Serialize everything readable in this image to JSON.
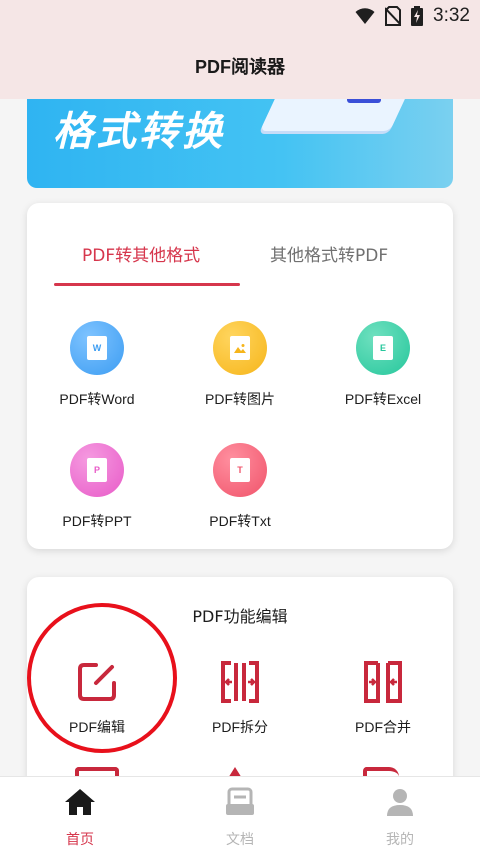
{
  "status": {
    "time": "3:32"
  },
  "appbar": {
    "title": "PDF阅读器"
  },
  "banner": {
    "text": "格式转换"
  },
  "convert": {
    "tabs": [
      {
        "label": "PDF转其他格式",
        "active": true
      },
      {
        "label": "其他格式转PDF",
        "active": false
      }
    ],
    "items": [
      {
        "label": "PDF转Word",
        "icon": "word-icon",
        "letter": "W",
        "color": "#3d9df2"
      },
      {
        "label": "PDF转图片",
        "icon": "image-icon",
        "letter": "",
        "color": "#f6b51a"
      },
      {
        "label": "PDF转Excel",
        "icon": "excel-icon",
        "letter": "E",
        "color": "#26c79c"
      },
      {
        "label": "PDF转PPT",
        "icon": "ppt-icon",
        "letter": "P",
        "color": "#e85bc8"
      },
      {
        "label": "PDF转Txt",
        "icon": "txt-icon",
        "letter": "T",
        "color": "#f0536a"
      }
    ]
  },
  "edit": {
    "title": "PDF功能编辑",
    "items": [
      {
        "label": "PDF编辑",
        "icon": "edit-icon"
      },
      {
        "label": "PDF拆分",
        "icon": "split-icon"
      },
      {
        "label": "PDF合并",
        "icon": "merge-icon"
      }
    ]
  },
  "bottom_nav": [
    {
      "label": "首页",
      "icon": "home-icon",
      "active": true
    },
    {
      "label": "文档",
      "icon": "document-icon",
      "active": false
    },
    {
      "label": "我的",
      "icon": "profile-icon",
      "active": false
    }
  ],
  "colors": {
    "accent": "#d6364c",
    "icon_red": "#c8283c",
    "inactive": "#b5b5b5",
    "highlight": "#e8101b"
  }
}
